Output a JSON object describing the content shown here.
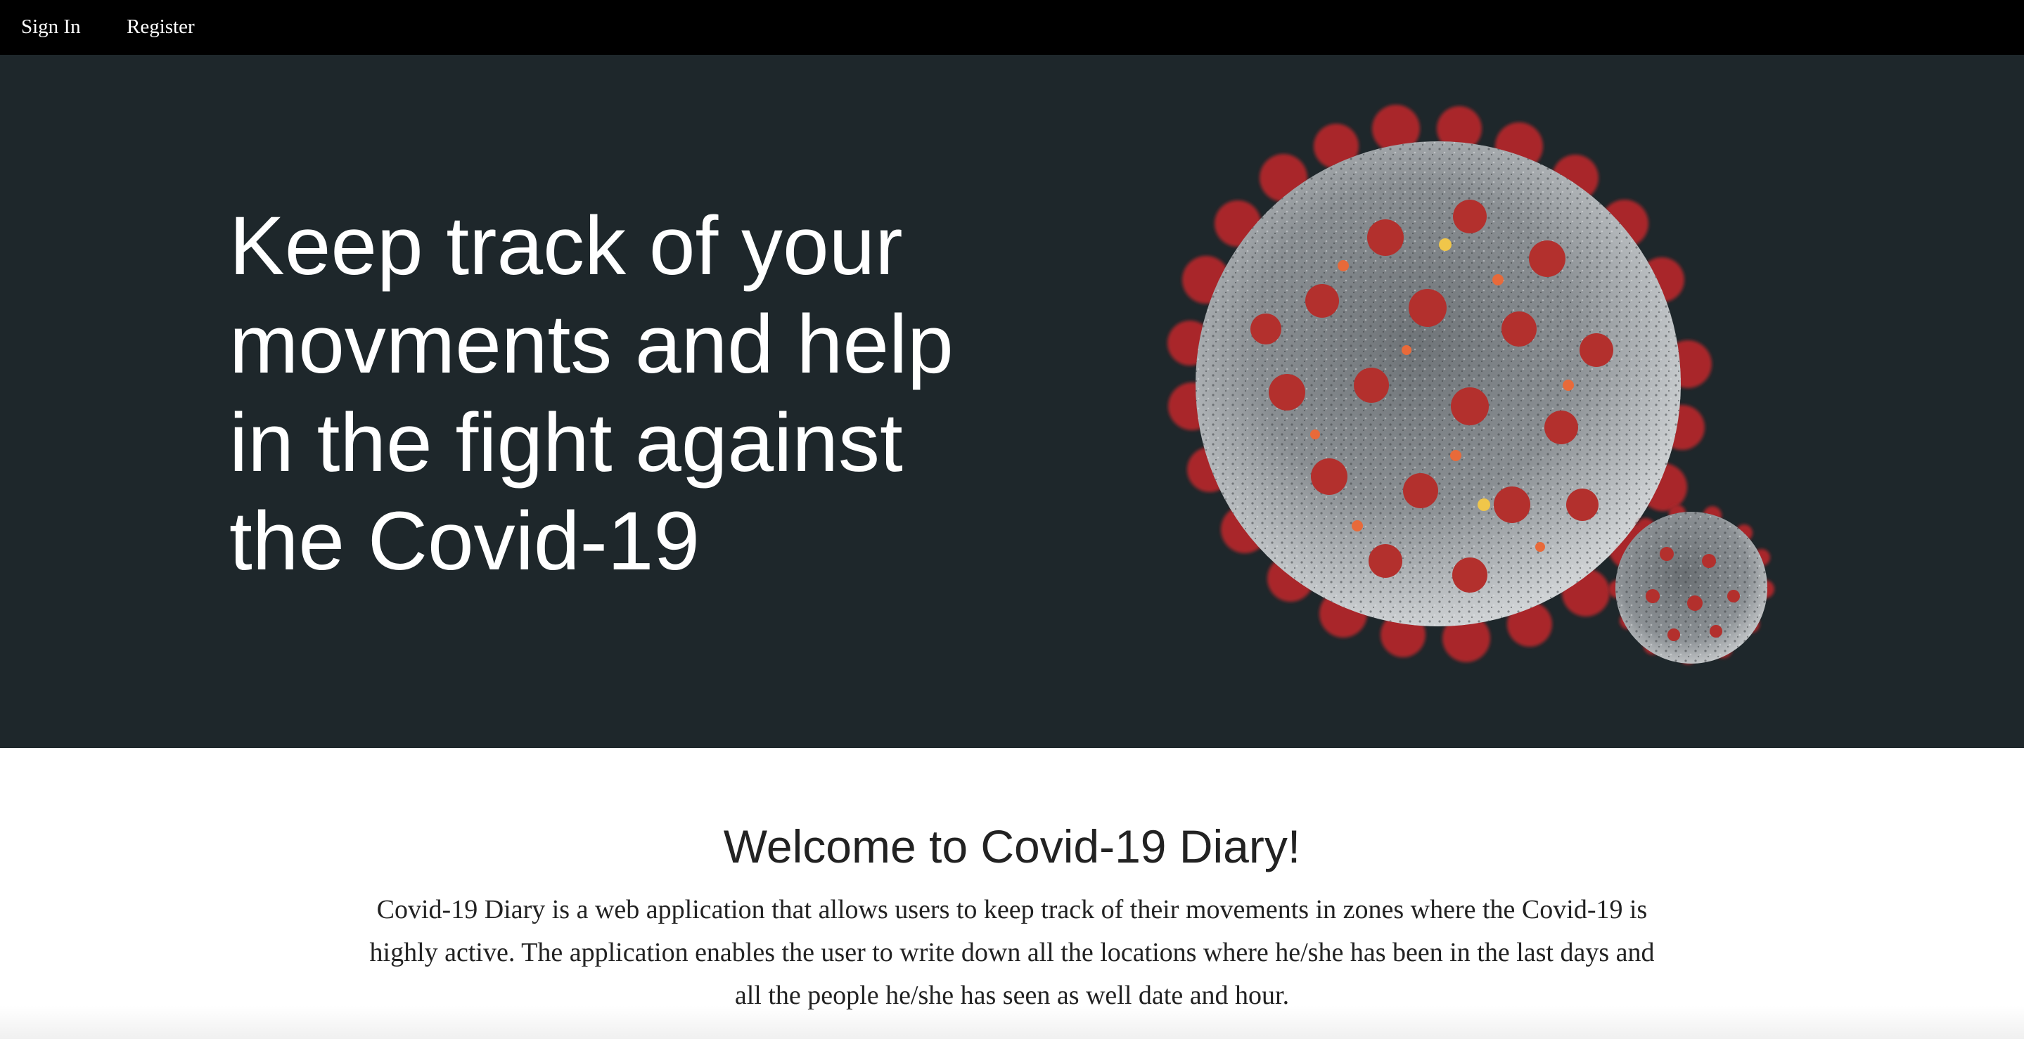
{
  "nav": {
    "sign_in_label": "Sign In",
    "register_label": "Register"
  },
  "hero": {
    "title": "Keep track of your movments and help in the fight against the Covid-19",
    "image_subject": "coronavirus-illustration"
  },
  "intro": {
    "heading": "Welcome to Covid-19 Diary!",
    "description": "Covid-19 Diary is a web application that allows users to keep track of their movements in zones where the Covid-19 is highly active. The application enables the user to write down all the locations where he/she has been in the last days and all the people he/she has seen as well date and hour."
  },
  "colors": {
    "navbar_bg": "#000000",
    "hero_bg": "#1e272b",
    "hero_text": "#ffffff",
    "page_bg": "#ffffff",
    "body_text": "#222222",
    "spike_red": "#b3302d",
    "virus_gray": "#8a8f93"
  }
}
